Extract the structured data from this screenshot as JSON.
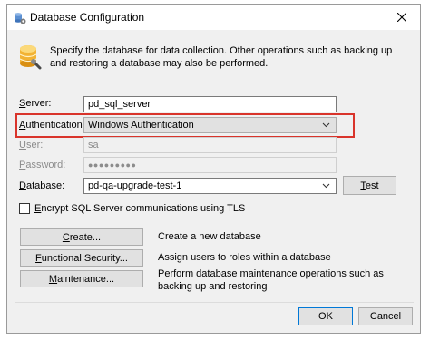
{
  "window": {
    "title": "Database Configuration"
  },
  "intro_text": "Specify the database for data collection. Other operations such as backing up and restoring a database may also be performed.",
  "fields": {
    "server": {
      "label_prefix": "S",
      "label_rest": "erver:",
      "value": "pd_sql_server"
    },
    "authentication": {
      "label_prefix": "A",
      "label_rest": "uthentication:",
      "value": "Windows Authentication"
    },
    "user": {
      "label_prefix": "U",
      "label_rest": "ser:",
      "value": "sa"
    },
    "password": {
      "label_prefix": "P",
      "label_rest": "assword:",
      "value": "●●●●●●●●●"
    },
    "database": {
      "label_prefix": "D",
      "label_rest": "atabase:",
      "value": "pd-qa-upgrade-test-1"
    }
  },
  "test_button": {
    "prefix": "T",
    "rest": "est"
  },
  "encrypt": {
    "label_prefix": "E",
    "label_rest": "ncrypt SQL Server communications using TLS",
    "checked": false
  },
  "actions": [
    {
      "prefix": "C",
      "rest": "reate...",
      "description": "Create a new database"
    },
    {
      "prefix": "F",
      "rest": "unctional Security...",
      "description": "Assign users to roles within a database"
    },
    {
      "prefix": "M",
      "rest": "aintenance...",
      "description": "Perform database maintenance operations such as backing up and restoring"
    }
  ],
  "footer": {
    "ok": "OK",
    "cancel": "Cancel"
  },
  "colors": {
    "highlight": "#d9342b",
    "dialog_bg": "#f0f0f0"
  }
}
